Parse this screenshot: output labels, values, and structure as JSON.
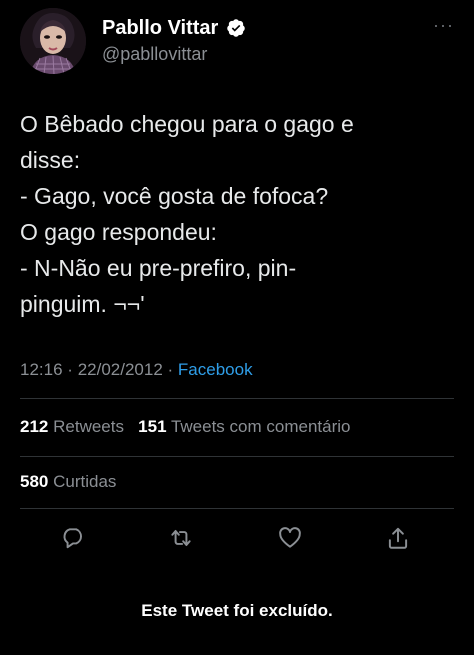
{
  "user": {
    "display_name": "Pabllo Vittar",
    "handle": "@pabllovittar",
    "verified_icon": "verified-badge-icon"
  },
  "tweet": {
    "lines": [
      "O Bêbado chegou para o gago e",
      "disse:",
      "- Gago, você gosta de fofoca?",
      "O gago respondeu:",
      "- N-Não eu pre-prefiro, pin-",
      "pinguim. ¬¬'"
    ],
    "time": "12:16",
    "separator": "·",
    "date": "22/02/2012",
    "source": "Facebook"
  },
  "stats": {
    "retweets_count": "212",
    "retweets_label": "Retweets",
    "quotes_count": "151",
    "quotes_label": "Tweets com comentário",
    "likes_count": "580",
    "likes_label": "Curtidas"
  },
  "actions": {
    "reply_icon": "reply-icon",
    "retweet_icon": "retweet-icon",
    "like_icon": "heart-icon",
    "share_icon": "share-icon",
    "more_icon": "more-icon"
  },
  "notice": "Este Tweet foi excluído.",
  "colors": {
    "background": "#000000",
    "text": "#e7e9ea",
    "muted": "#8b8f94",
    "link": "#2f9ee8",
    "verified": "#ffffff"
  }
}
